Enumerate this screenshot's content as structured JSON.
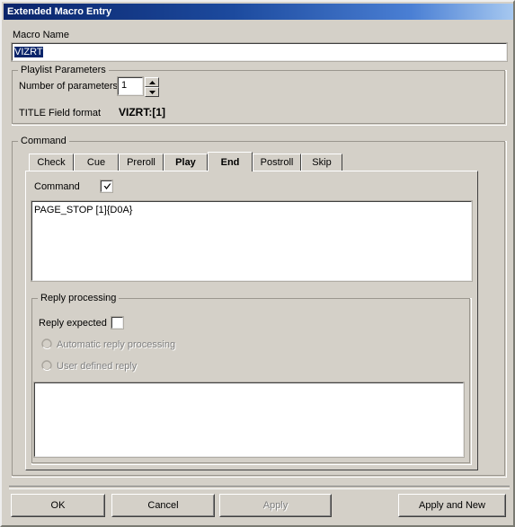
{
  "window": {
    "title": "Extended Macro Entry"
  },
  "macro_name": {
    "label": "Macro Name",
    "value": "VIZRT"
  },
  "playlist_parameters": {
    "legend": "Playlist Parameters",
    "number_of_parameters_label": "Number of parameters",
    "number_of_parameters_value": "1",
    "title_field_format_label": "TITLE Field format",
    "title_field_format_value": "VIZRT:[1]"
  },
  "command_group": {
    "legend": "Command",
    "tabs": [
      {
        "label": "Check",
        "selected": false,
        "bold": false
      },
      {
        "label": "Cue",
        "selected": false,
        "bold": false
      },
      {
        "label": "Preroll",
        "selected": false,
        "bold": false
      },
      {
        "label": "Play",
        "selected": false,
        "bold": true
      },
      {
        "label": "End",
        "selected": true,
        "bold": true
      },
      {
        "label": "Postroll",
        "selected": false,
        "bold": false
      },
      {
        "label": "Skip",
        "selected": false,
        "bold": false
      }
    ],
    "command_checkbox_label": "Command",
    "command_checkbox_checked": true,
    "command_text": "PAGE_STOP [1]{D0A}"
  },
  "reply_processing": {
    "legend": "Reply processing",
    "reply_expected_label": "Reply expected",
    "reply_expected_checked": false,
    "automatic_reply_label": "Automatic reply processing",
    "automatic_reply_selected": false,
    "automatic_reply_enabled": false,
    "user_defined_reply_label": "User defined reply",
    "user_defined_reply_selected": false,
    "user_defined_reply_enabled": false,
    "reply_text": ""
  },
  "footer": {
    "ok_label": "OK",
    "cancel_label": "Cancel",
    "apply_label": "Apply",
    "apply_enabled": false,
    "apply_and_new_label": "Apply and New"
  },
  "colors": {
    "dialog_face": "#d4d0c8",
    "title_gradient_start": "#0a246a",
    "title_gradient_end": "#a6c8f0",
    "selection": "#0a246a",
    "disabled_text": "#808080",
    "field_background": "#ffffff"
  }
}
